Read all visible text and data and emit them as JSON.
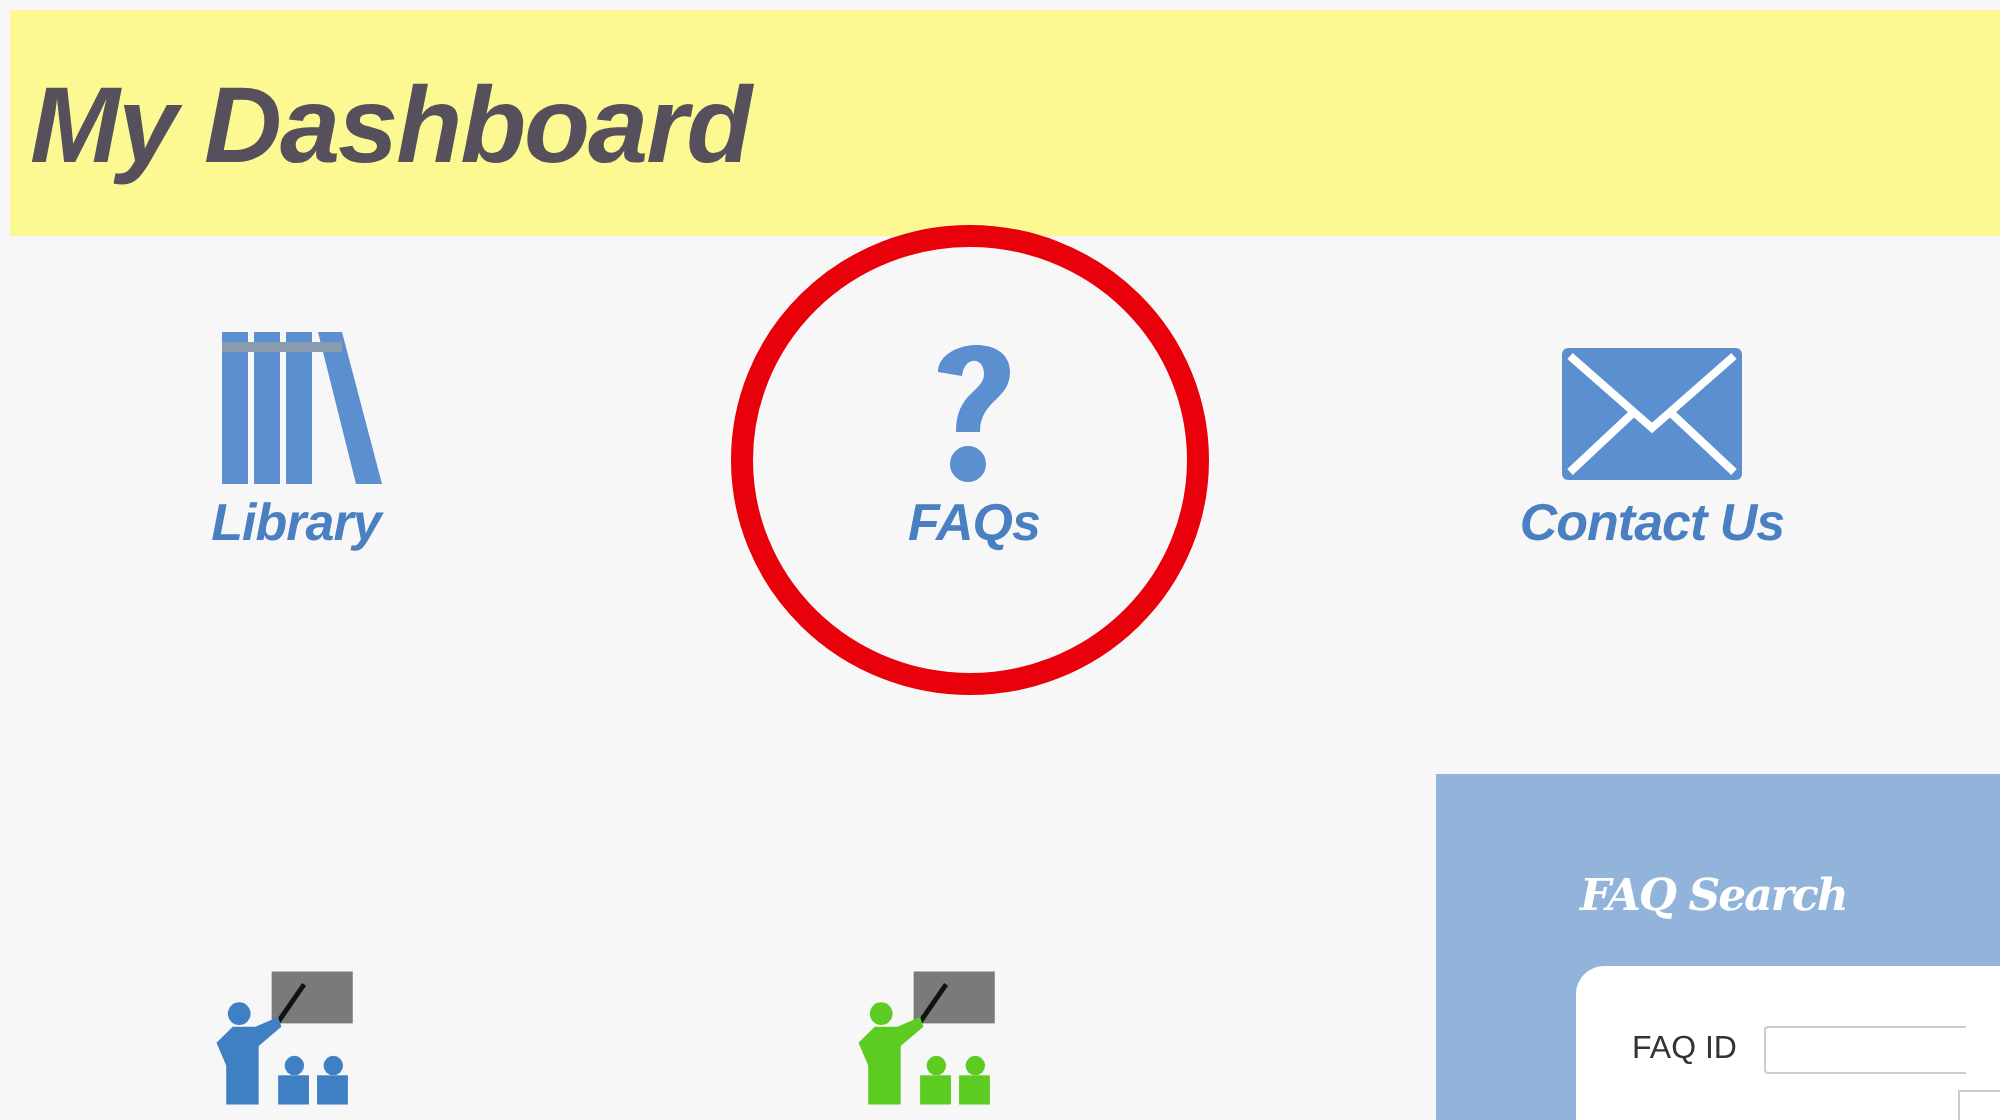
{
  "header": {
    "title": "My Dashboard"
  },
  "tiles": [
    {
      "label": "Library",
      "kind": "library",
      "highlighted": false
    },
    {
      "label": "FAQs",
      "kind": "question",
      "highlighted": true
    },
    {
      "label": "Contact Us",
      "kind": "envelope",
      "highlighted": false
    }
  ],
  "training_icons": [
    {
      "color": "#3f7fc4"
    },
    {
      "color": "#5ccc22"
    }
  ],
  "search_panel": {
    "title": "FAQ Search",
    "fields": [
      {
        "label": "FAQ ID"
      }
    ]
  }
}
